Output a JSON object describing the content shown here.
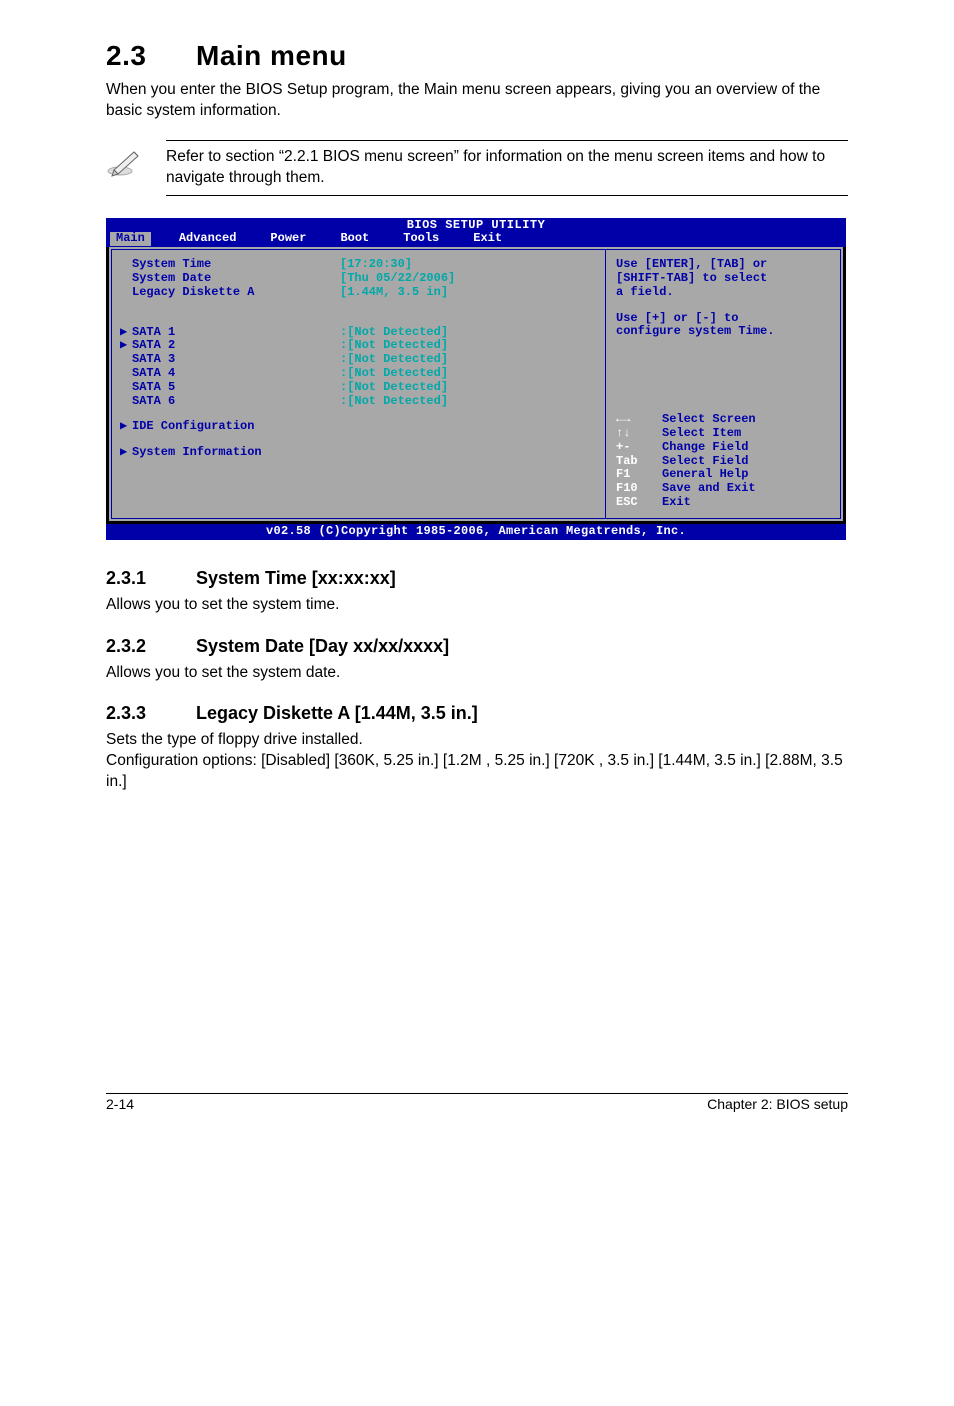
{
  "heading": {
    "num": "2.3",
    "title": "Main menu"
  },
  "intro": "When you enter the BIOS Setup program, the Main menu screen appears, giving you an overview of the basic system information.",
  "note": "Refer to section “2.2.1  BIOS menu screen” for information on the menu screen items and how to navigate through them.",
  "bios": {
    "title": "BIOS SETUP UTILITY",
    "menu": [
      "Main",
      "Advanced",
      "Power",
      "Boot",
      "Tools",
      "Exit"
    ],
    "selected_menu": "Main",
    "left_rows": [
      {
        "label": "System Time",
        "value": "[17:20:30]",
        "tri": false
      },
      {
        "label": "System Date",
        "value": "[Thu 05/22/2006]",
        "tri": false
      },
      {
        "label": "Legacy Diskette A",
        "value": "[1.44M, 3.5 in]",
        "tri": false
      }
    ],
    "sata_rows": [
      {
        "label": "SATA 1",
        "value": ":[Not Detected]",
        "tri": true
      },
      {
        "label": "SATA 2",
        "value": ":[Not Detected]",
        "tri": true
      },
      {
        "label": "SATA 3",
        "value": ":[Not Detected]",
        "tri": false
      },
      {
        "label": "SATA 4",
        "value": ":[Not Detected]",
        "tri": false
      },
      {
        "label": "SATA 5",
        "value": ":[Not Detected]",
        "tri": false
      },
      {
        "label": "SATA 6",
        "value": ":[Not Detected]",
        "tri": false
      }
    ],
    "extra_rows": [
      {
        "label": "IDE Configuration",
        "tri": true
      },
      {
        "label": "System Information",
        "tri": true
      }
    ],
    "help_top": [
      "Use [ENTER], [TAB] or",
      "[SHIFT-TAB] to select",
      "a field.",
      "",
      "Use [+] or [-] to",
      "configure system Time."
    ],
    "help_keys": [
      {
        "key": "←→",
        "label": "Select Screen"
      },
      {
        "key": "↑↓",
        "label": "Select Item"
      },
      {
        "key": "+-",
        "label": "Change Field"
      },
      {
        "key": "Tab",
        "label": "Select Field"
      },
      {
        "key": "F1",
        "label": "General Help"
      },
      {
        "key": "F10",
        "label": "Save and Exit"
      },
      {
        "key": "ESC",
        "label": "Exit"
      }
    ],
    "footer": "v02.58 (C)Copyright 1985-2006, American Megatrends, Inc."
  },
  "subsections": [
    {
      "num": "2.3.1",
      "title": "System Time [xx:xx:xx]",
      "body": "Allows you to set the system time."
    },
    {
      "num": "2.3.2",
      "title": "System Date [Day xx/xx/xxxx]",
      "body": "Allows you to set the system date."
    },
    {
      "num": "2.3.3",
      "title": "Legacy Diskette A [1.44M, 3.5 in.]",
      "body": "Sets the type of floppy drive installed.\nConfiguration options: [Disabled] [360K, 5.25 in.] [1.2M , 5.25 in.] [720K , 3.5 in.] [1.44M, 3.5 in.] [2.88M, 3.5 in.]"
    }
  ],
  "footer": {
    "left": "2-14",
    "right": "Chapter 2: BIOS setup"
  }
}
